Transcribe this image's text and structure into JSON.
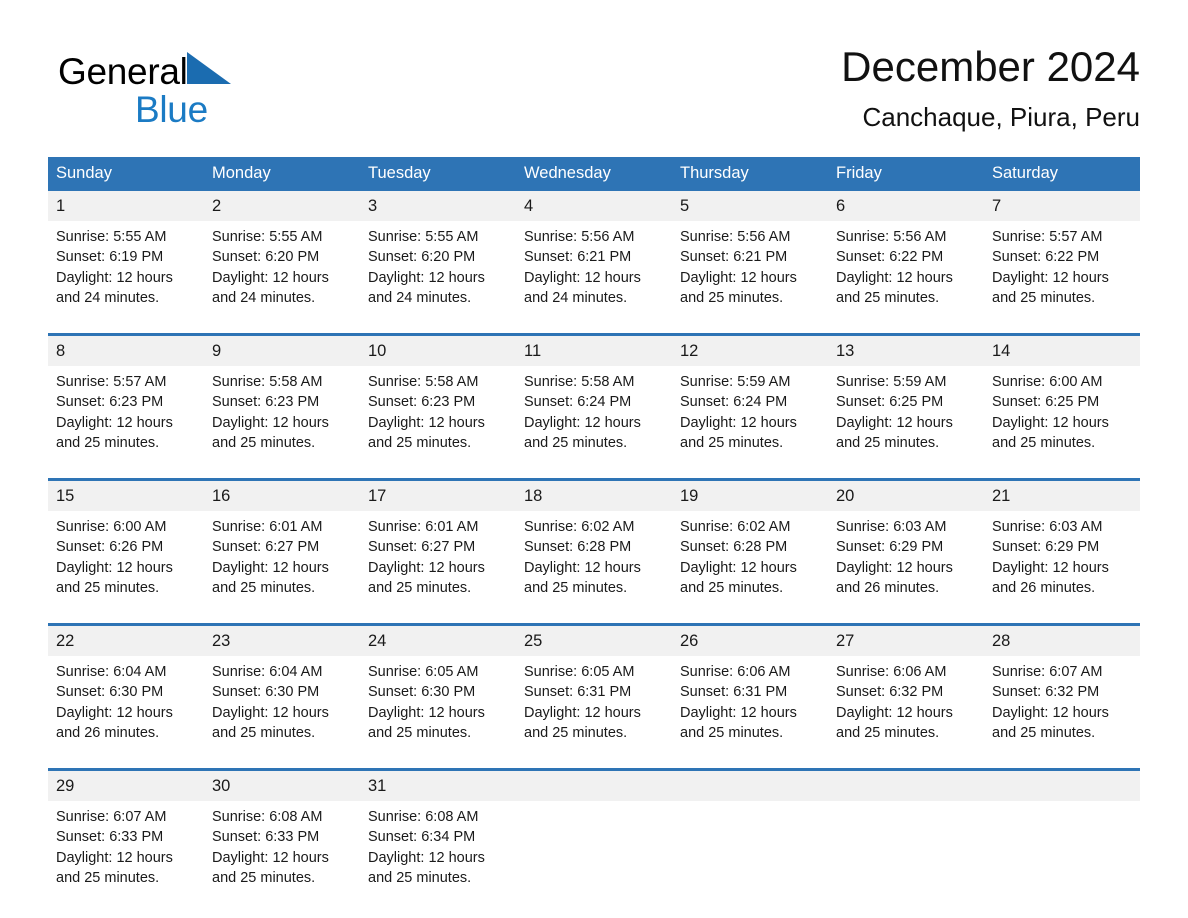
{
  "brand": {
    "name_part1": "General",
    "name_part2": "Blue",
    "logo_icon": "triangle-logo-icon",
    "accent_color": "#1B7BC4"
  },
  "header": {
    "title": "December 2024",
    "subtitle": "Canchaque, Piura, Peru"
  },
  "theme": {
    "header_blue": "#2E74B5",
    "daynum_bg": "#F1F1F1",
    "text": "#1a1a1a"
  },
  "calendar": {
    "weekday_headers": [
      "Sunday",
      "Monday",
      "Tuesday",
      "Wednesday",
      "Thursday",
      "Friday",
      "Saturday"
    ],
    "weeks": [
      [
        {
          "day": "1",
          "sunrise": "Sunrise: 5:55 AM",
          "sunset": "Sunset: 6:19 PM",
          "daylight": "Daylight: 12 hours and 24 minutes."
        },
        {
          "day": "2",
          "sunrise": "Sunrise: 5:55 AM",
          "sunset": "Sunset: 6:20 PM",
          "daylight": "Daylight: 12 hours and 24 minutes."
        },
        {
          "day": "3",
          "sunrise": "Sunrise: 5:55 AM",
          "sunset": "Sunset: 6:20 PM",
          "daylight": "Daylight: 12 hours and 24 minutes."
        },
        {
          "day": "4",
          "sunrise": "Sunrise: 5:56 AM",
          "sunset": "Sunset: 6:21 PM",
          "daylight": "Daylight: 12 hours and 24 minutes."
        },
        {
          "day": "5",
          "sunrise": "Sunrise: 5:56 AM",
          "sunset": "Sunset: 6:21 PM",
          "daylight": "Daylight: 12 hours and 25 minutes."
        },
        {
          "day": "6",
          "sunrise": "Sunrise: 5:56 AM",
          "sunset": "Sunset: 6:22 PM",
          "daylight": "Daylight: 12 hours and 25 minutes."
        },
        {
          "day": "7",
          "sunrise": "Sunrise: 5:57 AM",
          "sunset": "Sunset: 6:22 PM",
          "daylight": "Daylight: 12 hours and 25 minutes."
        }
      ],
      [
        {
          "day": "8",
          "sunrise": "Sunrise: 5:57 AM",
          "sunset": "Sunset: 6:23 PM",
          "daylight": "Daylight: 12 hours and 25 minutes."
        },
        {
          "day": "9",
          "sunrise": "Sunrise: 5:58 AM",
          "sunset": "Sunset: 6:23 PM",
          "daylight": "Daylight: 12 hours and 25 minutes."
        },
        {
          "day": "10",
          "sunrise": "Sunrise: 5:58 AM",
          "sunset": "Sunset: 6:23 PM",
          "daylight": "Daylight: 12 hours and 25 minutes."
        },
        {
          "day": "11",
          "sunrise": "Sunrise: 5:58 AM",
          "sunset": "Sunset: 6:24 PM",
          "daylight": "Daylight: 12 hours and 25 minutes."
        },
        {
          "day": "12",
          "sunrise": "Sunrise: 5:59 AM",
          "sunset": "Sunset: 6:24 PM",
          "daylight": "Daylight: 12 hours and 25 minutes."
        },
        {
          "day": "13",
          "sunrise": "Sunrise: 5:59 AM",
          "sunset": "Sunset: 6:25 PM",
          "daylight": "Daylight: 12 hours and 25 minutes."
        },
        {
          "day": "14",
          "sunrise": "Sunrise: 6:00 AM",
          "sunset": "Sunset: 6:25 PM",
          "daylight": "Daylight: 12 hours and 25 minutes."
        }
      ],
      [
        {
          "day": "15",
          "sunrise": "Sunrise: 6:00 AM",
          "sunset": "Sunset: 6:26 PM",
          "daylight": "Daylight: 12 hours and 25 minutes."
        },
        {
          "day": "16",
          "sunrise": "Sunrise: 6:01 AM",
          "sunset": "Sunset: 6:27 PM",
          "daylight": "Daylight: 12 hours and 25 minutes."
        },
        {
          "day": "17",
          "sunrise": "Sunrise: 6:01 AM",
          "sunset": "Sunset: 6:27 PM",
          "daylight": "Daylight: 12 hours and 25 minutes."
        },
        {
          "day": "18",
          "sunrise": "Sunrise: 6:02 AM",
          "sunset": "Sunset: 6:28 PM",
          "daylight": "Daylight: 12 hours and 25 minutes."
        },
        {
          "day": "19",
          "sunrise": "Sunrise: 6:02 AM",
          "sunset": "Sunset: 6:28 PM",
          "daylight": "Daylight: 12 hours and 25 minutes."
        },
        {
          "day": "20",
          "sunrise": "Sunrise: 6:03 AM",
          "sunset": "Sunset: 6:29 PM",
          "daylight": "Daylight: 12 hours and 26 minutes."
        },
        {
          "day": "21",
          "sunrise": "Sunrise: 6:03 AM",
          "sunset": "Sunset: 6:29 PM",
          "daylight": "Daylight: 12 hours and 26 minutes."
        }
      ],
      [
        {
          "day": "22",
          "sunrise": "Sunrise: 6:04 AM",
          "sunset": "Sunset: 6:30 PM",
          "daylight": "Daylight: 12 hours and 26 minutes."
        },
        {
          "day": "23",
          "sunrise": "Sunrise: 6:04 AM",
          "sunset": "Sunset: 6:30 PM",
          "daylight": "Daylight: 12 hours and 25 minutes."
        },
        {
          "day": "24",
          "sunrise": "Sunrise: 6:05 AM",
          "sunset": "Sunset: 6:30 PM",
          "daylight": "Daylight: 12 hours and 25 minutes."
        },
        {
          "day": "25",
          "sunrise": "Sunrise: 6:05 AM",
          "sunset": "Sunset: 6:31 PM",
          "daylight": "Daylight: 12 hours and 25 minutes."
        },
        {
          "day": "26",
          "sunrise": "Sunrise: 6:06 AM",
          "sunset": "Sunset: 6:31 PM",
          "daylight": "Daylight: 12 hours and 25 minutes."
        },
        {
          "day": "27",
          "sunrise": "Sunrise: 6:06 AM",
          "sunset": "Sunset: 6:32 PM",
          "daylight": "Daylight: 12 hours and 25 minutes."
        },
        {
          "day": "28",
          "sunrise": "Sunrise: 6:07 AM",
          "sunset": "Sunset: 6:32 PM",
          "daylight": "Daylight: 12 hours and 25 minutes."
        }
      ],
      [
        {
          "day": "29",
          "sunrise": "Sunrise: 6:07 AM",
          "sunset": "Sunset: 6:33 PM",
          "daylight": "Daylight: 12 hours and 25 minutes."
        },
        {
          "day": "30",
          "sunrise": "Sunrise: 6:08 AM",
          "sunset": "Sunset: 6:33 PM",
          "daylight": "Daylight: 12 hours and 25 minutes."
        },
        {
          "day": "31",
          "sunrise": "Sunrise: 6:08 AM",
          "sunset": "Sunset: 6:34 PM",
          "daylight": "Daylight: 12 hours and 25 minutes."
        },
        {
          "day": "",
          "sunrise": "",
          "sunset": "",
          "daylight": ""
        },
        {
          "day": "",
          "sunrise": "",
          "sunset": "",
          "daylight": ""
        },
        {
          "day": "",
          "sunrise": "",
          "sunset": "",
          "daylight": ""
        },
        {
          "day": "",
          "sunrise": "",
          "sunset": "",
          "daylight": ""
        }
      ]
    ]
  }
}
